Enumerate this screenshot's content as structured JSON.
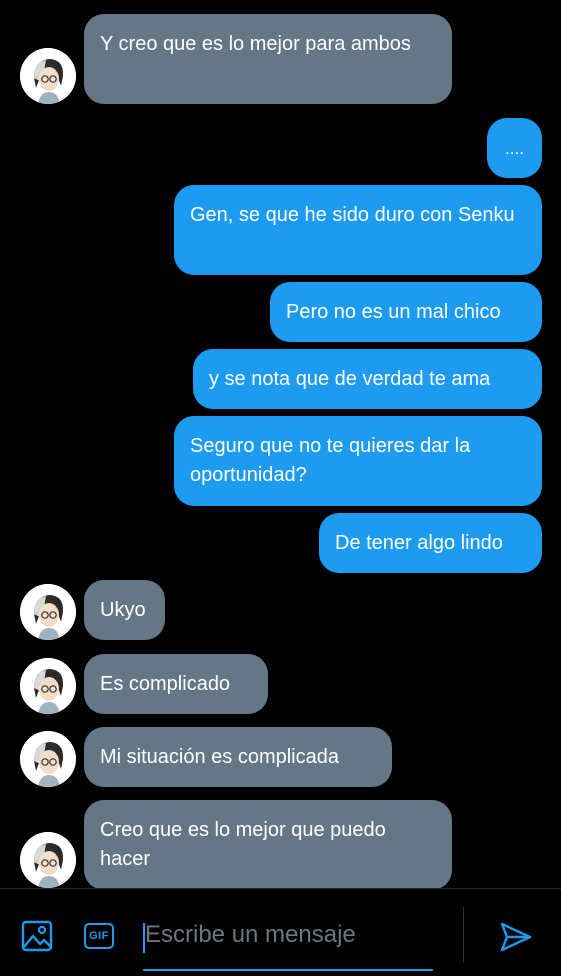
{
  "messages": [
    {
      "side": "in",
      "text": "Y creo que es lo mejor para ambos"
    },
    {
      "side": "out",
      "text": "...."
    },
    {
      "side": "out",
      "text": "Gen, se que he sido duro con Senku"
    },
    {
      "side": "out",
      "text": "Pero no es un mal chico"
    },
    {
      "side": "out",
      "text": "y se nota que de verdad te ama"
    },
    {
      "side": "out",
      "text": "Seguro que no te quieres dar la oportunidad?"
    },
    {
      "side": "out",
      "text": "De tener algo lindo"
    },
    {
      "side": "in",
      "text": "Ukyo"
    },
    {
      "side": "in",
      "text": "Es complicado"
    },
    {
      "side": "in",
      "text": "Mi situación es complicada"
    },
    {
      "side": "in",
      "text": "Creo que es lo mejor que puedo hacer"
    }
  ],
  "composer": {
    "placeholder": "Escribe un mensaje",
    "image_icon": "image-icon",
    "gif_label": "GIF",
    "send_icon": "send-icon"
  },
  "colors": {
    "background": "#000000",
    "outgoing_bubble": "#1d9bf0",
    "incoming_bubble": "#657786",
    "accent": "#1d9bf0"
  }
}
